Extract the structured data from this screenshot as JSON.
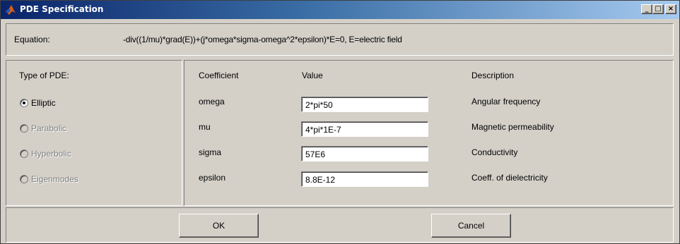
{
  "window": {
    "title": "PDE Specification"
  },
  "equation": {
    "label": "Equation:",
    "text": "-div((1/mu)*grad(E))+(j*omega*sigma-omega^2*epsilon)*E=0, E=electric field"
  },
  "pde_type": {
    "title": "Type of PDE:",
    "options": [
      {
        "label": "Elliptic",
        "selected": true,
        "enabled": true
      },
      {
        "label": "Parabolic",
        "selected": false,
        "enabled": false
      },
      {
        "label": "Hyperbolic",
        "selected": false,
        "enabled": false
      },
      {
        "label": "Eigenmodes",
        "selected": false,
        "enabled": false
      }
    ]
  },
  "coefficients": {
    "headers": {
      "coefficient": "Coefficient",
      "value": "Value",
      "description": "Description"
    },
    "rows": [
      {
        "name": "omega",
        "value": "2*pi*50",
        "description": "Angular frequency"
      },
      {
        "name": "mu",
        "value": "4*pi*1E-7",
        "description": "Magnetic permeability"
      },
      {
        "name": "sigma",
        "value": "57E6",
        "description": "Conductivity"
      },
      {
        "name": "epsilon",
        "value": "8.8E-12",
        "description": "Coeff. of dielectricity"
      }
    ]
  },
  "buttons": {
    "ok": "OK",
    "cancel": "Cancel"
  },
  "icons": {
    "app": "matlab-icon",
    "minimize": "minimize-icon",
    "maximize": "maximize-icon",
    "close": "close-icon"
  }
}
